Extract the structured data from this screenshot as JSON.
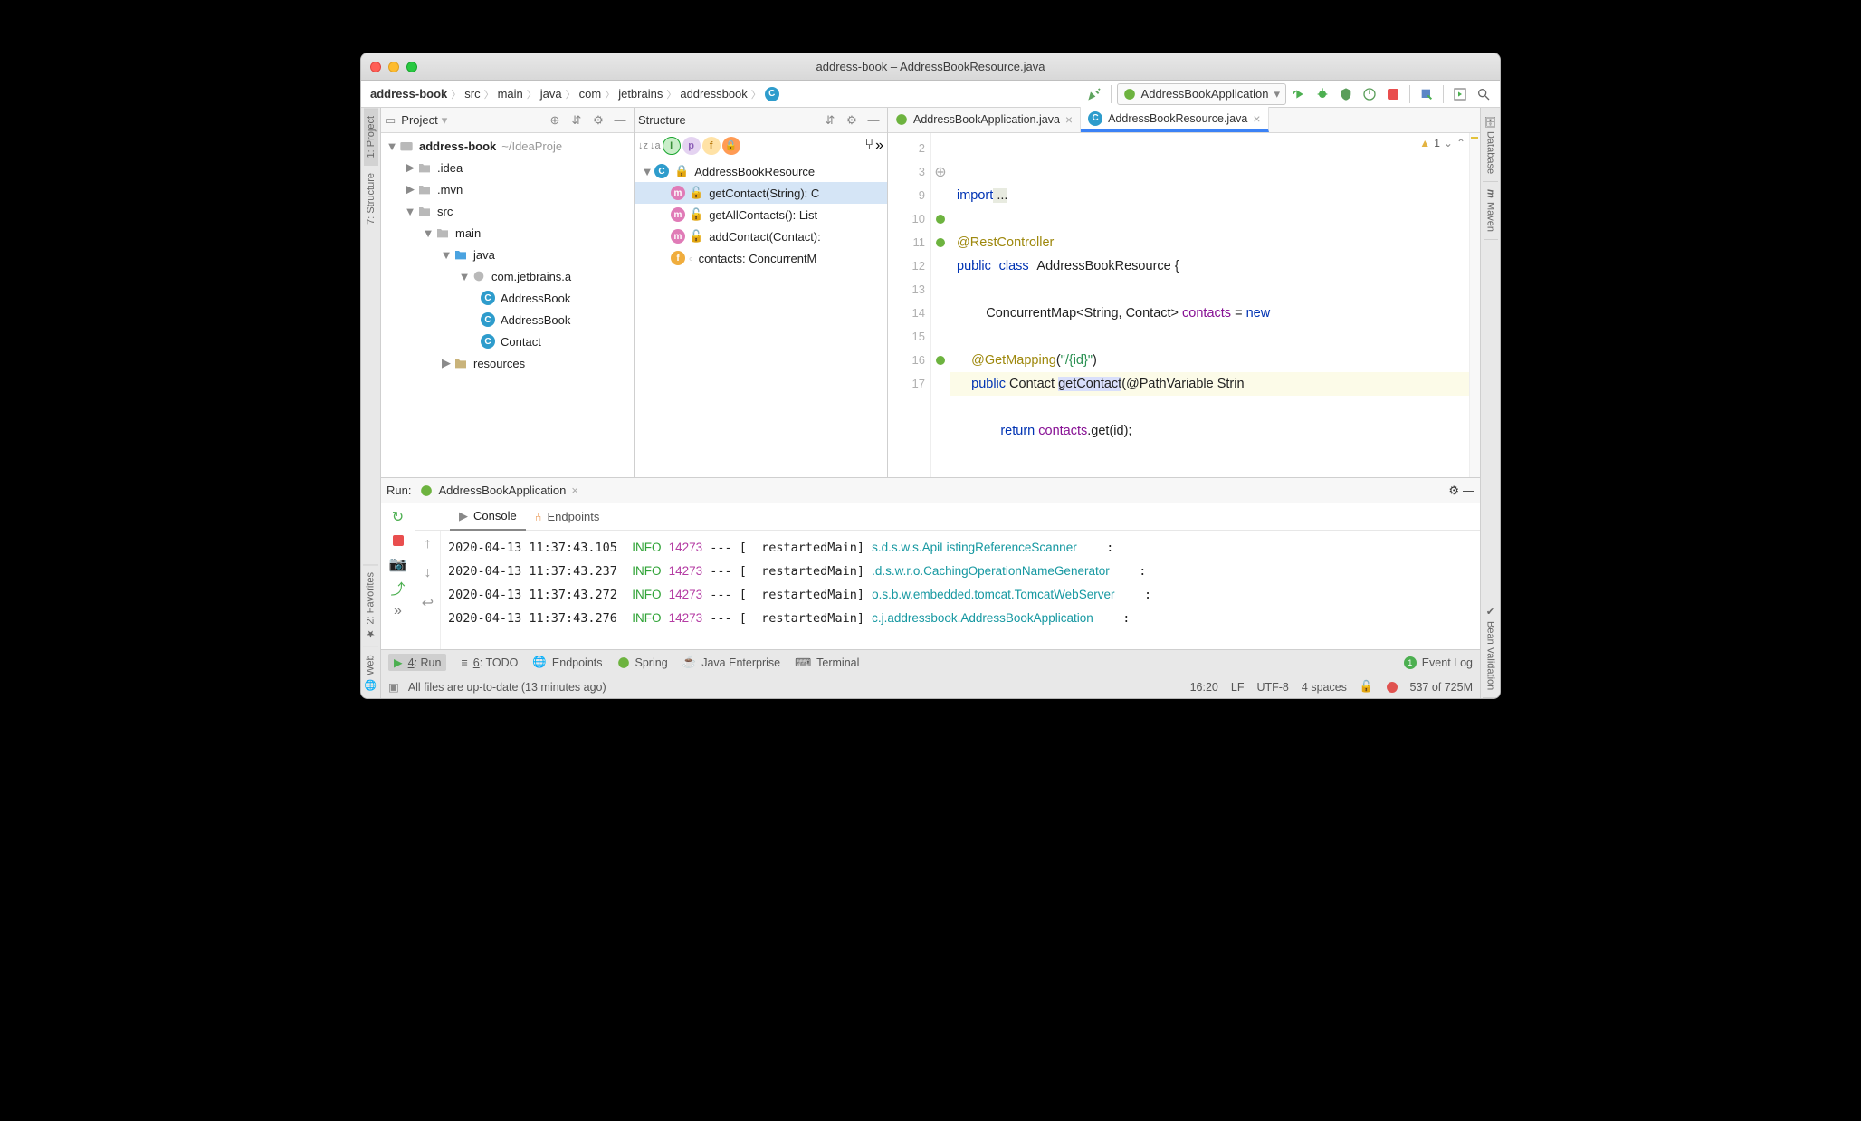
{
  "title": "address-book – AddressBookResource.java",
  "breadcrumbs": [
    "address-book",
    "src",
    "main",
    "java",
    "com",
    "jetbrains",
    "addressbook"
  ],
  "breadcrumb_file_icon": "C",
  "run_config": "AddressBookApplication",
  "side_left_tabs": {
    "project": "1: Project",
    "structure": "7: Structure",
    "favorites": "2: Favorites",
    "web": "Web"
  },
  "side_right_tabs": {
    "database": "Database",
    "maven": "Maven",
    "bean": "Bean Validation"
  },
  "project_header": "Project",
  "project_tree": {
    "root": {
      "name": "address-book",
      "hint": "~/IdeaProje"
    },
    "idea": ".idea",
    "mvn": ".mvn",
    "src": "src",
    "main": "main",
    "java": "java",
    "pkg": "com.jetbrains.a",
    "files": [
      "AddressBook",
      "AddressBook",
      "Contact"
    ],
    "resources": "resources"
  },
  "structure_header": "Structure",
  "structure": {
    "class": "AddressBookResource",
    "members": [
      {
        "icon": "m",
        "text": "getContact(String): C"
      },
      {
        "icon": "m",
        "text": "getAllContacts(): List"
      },
      {
        "icon": "m",
        "text": "addContact(Contact):"
      },
      {
        "icon": "f",
        "text": "contacts: ConcurrentM"
      }
    ]
  },
  "editor": {
    "tabs": [
      {
        "name": "AddressBookApplication.java",
        "active": false
      },
      {
        "name": "AddressBookResource.java",
        "active": true
      }
    ],
    "warnings": "1",
    "line_numbers": [
      "2",
      "3",
      "9",
      "10",
      "11",
      "12",
      "13",
      "14",
      "15",
      "16",
      "17"
    ],
    "code": {
      "l3_import": "import",
      "l3_rest": " ...",
      "l10": "@RestController",
      "l11_kpublic": "public",
      "l11_kclass": "class",
      "l11_cls": "AddressBookResource {",
      "l13_a": "        ConcurrentMap<String, Contact> ",
      "l13_fld": "contacts",
      "l13_b": " = ",
      "l13_new": "new",
      "l15_a": "    @GetMapping",
      "l15_b": "(",
      "l15_str": "\"/{id}\"",
      "l15_c": ")",
      "l16_kpublic": "public",
      "l16_ret": "Contact",
      "l16_m": "getContact",
      "l16_args": "(@PathVariable Strin",
      "l17_a": "            ",
      "l17_kret": "return",
      "l17_b": " ",
      "l17_fld": "contacts",
      "l17_c": ".get(id);"
    }
  },
  "run": {
    "title": "Run:",
    "config": "AddressBookApplication",
    "subtabs": {
      "console": "Console",
      "endpoints": "Endpoints"
    },
    "logs": [
      {
        "ts": "2020-04-13 11:37:43.105",
        "lvl": "INFO",
        "pid": "14273",
        "sep": "--- [",
        "th": "restartedMain]",
        "src": "s.d.s.w.s.ApiListingReferenceScanner",
        "tail": ":"
      },
      {
        "ts": "2020-04-13 11:37:43.237",
        "lvl": "INFO",
        "pid": "14273",
        "sep": "--- [",
        "th": "restartedMain]",
        "src": ".d.s.w.r.o.CachingOperationNameGenerator",
        "tail": ":"
      },
      {
        "ts": "2020-04-13 11:37:43.272",
        "lvl": "INFO",
        "pid": "14273",
        "sep": "--- [",
        "th": "restartedMain]",
        "src": "o.s.b.w.embedded.tomcat.TomcatWebServer",
        "tail": ":"
      },
      {
        "ts": "2020-04-13 11:37:43.276",
        "lvl": "INFO",
        "pid": "14273",
        "sep": "--- [",
        "th": "restartedMain]",
        "src": "c.j.addressbook.AddressBookApplication",
        "tail": ":"
      }
    ]
  },
  "bottom": {
    "run": "4: Run",
    "todo": "6: TODO",
    "endpoints": "Endpoints",
    "spring": "Spring",
    "javaee": "Java Enterprise",
    "terminal": "Terminal",
    "eventlog": "Event Log"
  },
  "status": {
    "msg": "All files are up-to-date (13 minutes ago)",
    "pos": "16:20",
    "lf": "LF",
    "enc": "UTF-8",
    "indent": "4 spaces",
    "mem": "537 of 725M"
  }
}
